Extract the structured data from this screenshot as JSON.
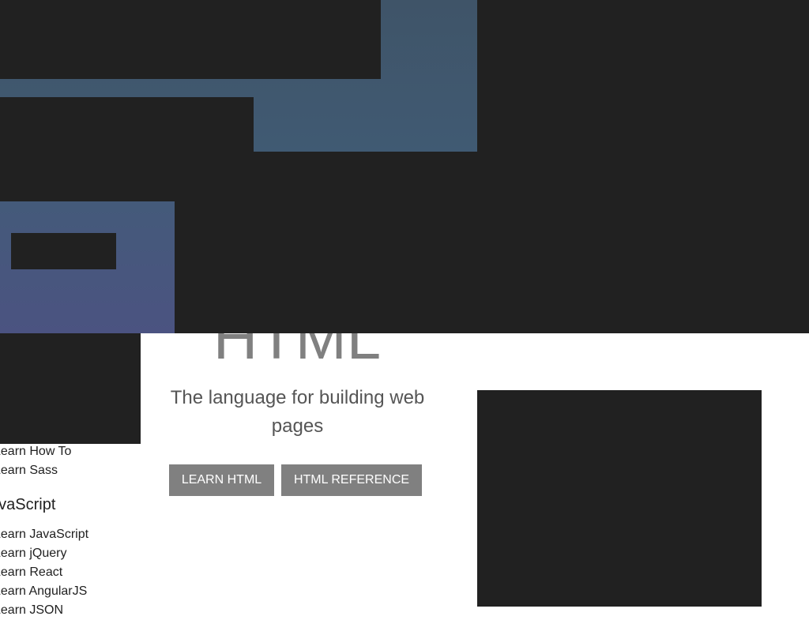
{
  "hero": {
    "title": "HTML",
    "subtitle": "The language for building web pages",
    "buttons": [
      "LEARN HTML",
      "HTML REFERENCE"
    ]
  },
  "sidebar": {
    "items_top": [
      "Learn How To",
      "Learn Sass"
    ],
    "section_heading": "JavaScript",
    "items_js": [
      "Learn JavaScript",
      "Learn jQuery",
      "Learn React",
      "Learn AngularJS",
      "Learn JSON"
    ]
  }
}
